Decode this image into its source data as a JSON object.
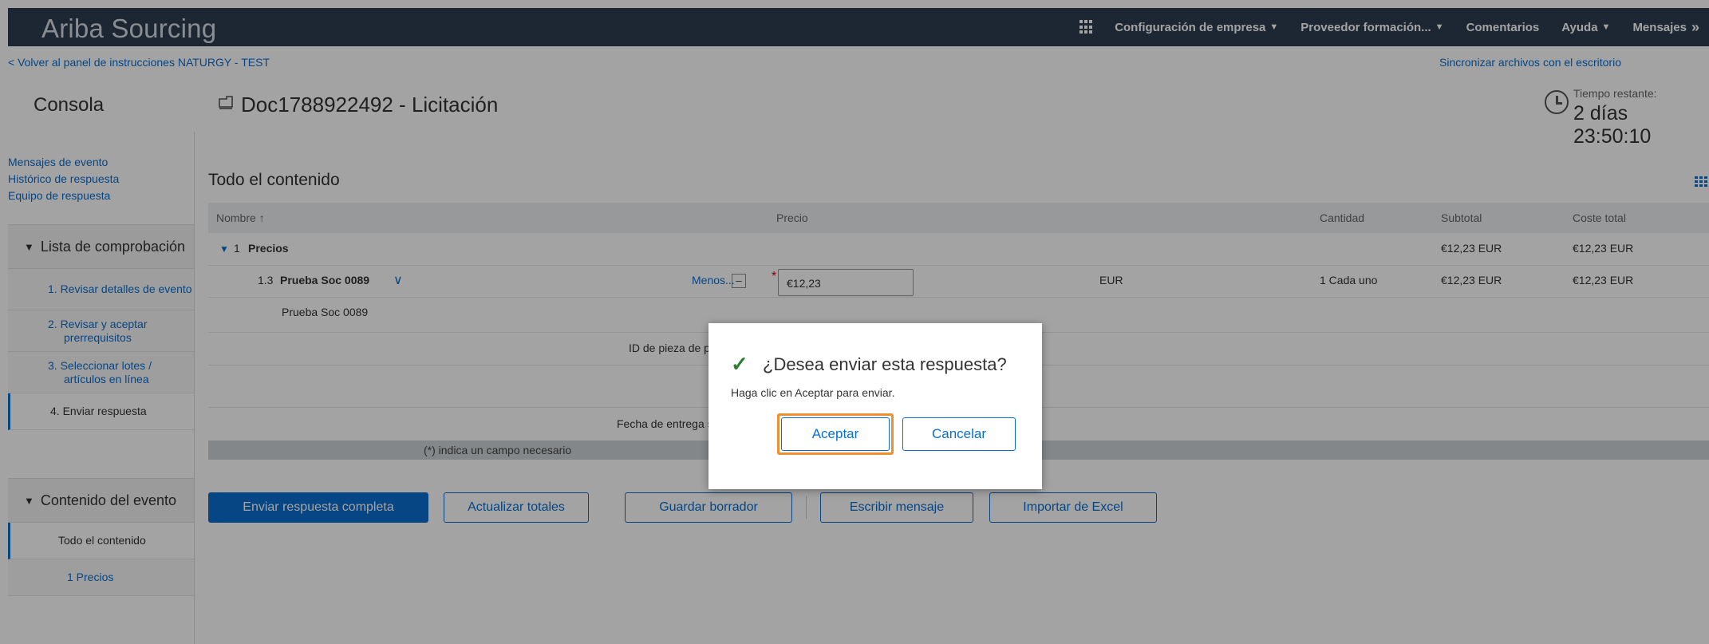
{
  "app": {
    "title": "Ariba Sourcing"
  },
  "topnav": {
    "company": "Configuración de empresa",
    "supplier": "Proveedor formación...",
    "comments": "Comentarios",
    "help": "Ayuda",
    "messages": "Mensajes",
    "messages_chevron": "»"
  },
  "subbar": {
    "back_link": "< Volver al panel de instrucciones NATURGY - TEST",
    "sync_link": "Sincronizar archivos con el escritorio"
  },
  "header": {
    "console": "Consola",
    "doc_title": "Doc1788922492 - Licitación",
    "time_label": "Tiempo restante:",
    "time_value": "2 días 23:50:10"
  },
  "sidebar": {
    "links": [
      "Mensajes de evento",
      "Histórico de respuesta",
      "Equipo de respuesta"
    ],
    "checklist_title": "Lista de comprobación",
    "steps": [
      {
        "label": "1.  Revisar detalles de evento"
      },
      {
        "label": "2.  Revisar y aceptar prerrequisitos"
      },
      {
        "label": "3.  Seleccionar lotes / artículos en línea"
      },
      {
        "label": "4.  Enviar respuesta"
      }
    ],
    "content_title": "Contenido del evento",
    "content_items": [
      "Todo el contenido",
      "1  Precios"
    ]
  },
  "main": {
    "title": "Todo el contenido",
    "columns": {
      "name": "Nombre",
      "sort_icon": "↑",
      "price": "Precio",
      "quantity": "Cantidad",
      "subtotal": "Subtotal",
      "total_cost": "Coste total"
    },
    "group": {
      "toggle": "▼",
      "index": "1",
      "name": "Precios",
      "subtotal": "€12,23 EUR",
      "total_cost": "€12,23 EUR"
    },
    "item": {
      "index": "1.3",
      "name": "Prueba Soc 0089",
      "less_label": "Menos...",
      "less_icon": "–",
      "required_mark": "*",
      "price_value": "€12,23",
      "currency": "EUR",
      "quantity": "1 Cada uno",
      "subtotal": "€12,23 EUR",
      "total_cost": "€12,23 EUR"
    },
    "description": "Prueba Soc 0089",
    "field_part_id": "ID de pieza de pr",
    "field_delivery": "Fecha de entrega s",
    "required_note": "(*) indica un campo necesario"
  },
  "buttons": {
    "submit": "Enviar respuesta completa",
    "update": "Actualizar totales",
    "draft": "Guardar borrador",
    "message": "Escribir mensaje",
    "excel": "Importar de Excel"
  },
  "dialog": {
    "check": "✓",
    "title": "¿Desea enviar esta respuesta?",
    "message": "Haga clic en Aceptar para enviar.",
    "accept": "Aceptar",
    "cancel": "Cancelar"
  }
}
